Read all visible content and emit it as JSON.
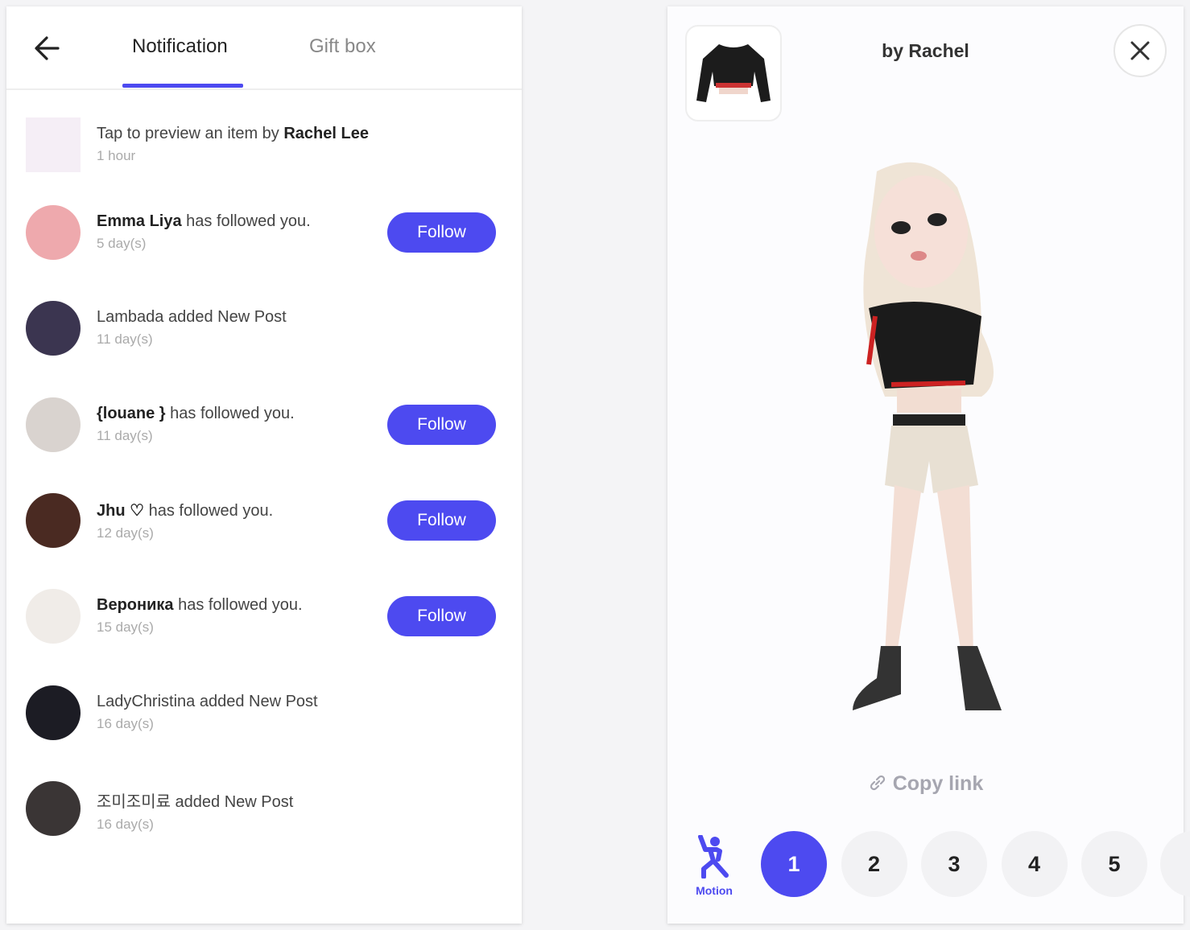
{
  "left": {
    "tabs": [
      {
        "label": "Notification",
        "active": true
      },
      {
        "label": "Gift box",
        "active": false
      }
    ],
    "accent": "#4d4af0",
    "notifications": [
      {
        "pre": "Tap to preview an item by ",
        "bold": "Rachel Lee",
        "post": "",
        "time": "1 hour",
        "follow": false,
        "avatar_color": "#f5eef6"
      },
      {
        "pre": "",
        "bold": "Emma Liya",
        "post": " has followed you.",
        "time": "5 day(s)",
        "follow": true,
        "avatar_color": "#eea9ad"
      },
      {
        "pre": "Lambada added New Post",
        "bold": "",
        "post": "",
        "time": "11 day(s)",
        "follow": false,
        "avatar_color": "#3b3550"
      },
      {
        "pre": "",
        "bold": "{louane }",
        "post": " has followed you.",
        "time": "11 day(s)",
        "follow": true,
        "avatar_color": "#d9d3cf"
      },
      {
        "pre": "",
        "bold": "Jhu ♡",
        "post": " has followed you.",
        "time": "12 day(s)",
        "follow": true,
        "avatar_color": "#4a2a22"
      },
      {
        "pre": "",
        "bold": "Вероника",
        "post": " has followed you.",
        "time": "15 day(s)",
        "follow": true,
        "avatar_color": "#f0ece8"
      },
      {
        "pre": "LadyChristina added New Post",
        "bold": "",
        "post": "",
        "time": "16 day(s)",
        "follow": false,
        "avatar_color": "#1c1c24"
      },
      {
        "pre": "조미조미료 added New Post",
        "bold": "",
        "post": "",
        "time": "16 day(s)",
        "follow": false,
        "avatar_color": "#3a3535"
      }
    ],
    "follow_label": "Follow"
  },
  "right": {
    "title": "by Rachel",
    "copy_link": "Copy link",
    "motion_label": "Motion",
    "motions": [
      "1",
      "2",
      "3",
      "4",
      "5"
    ],
    "selected_motion": "1"
  }
}
